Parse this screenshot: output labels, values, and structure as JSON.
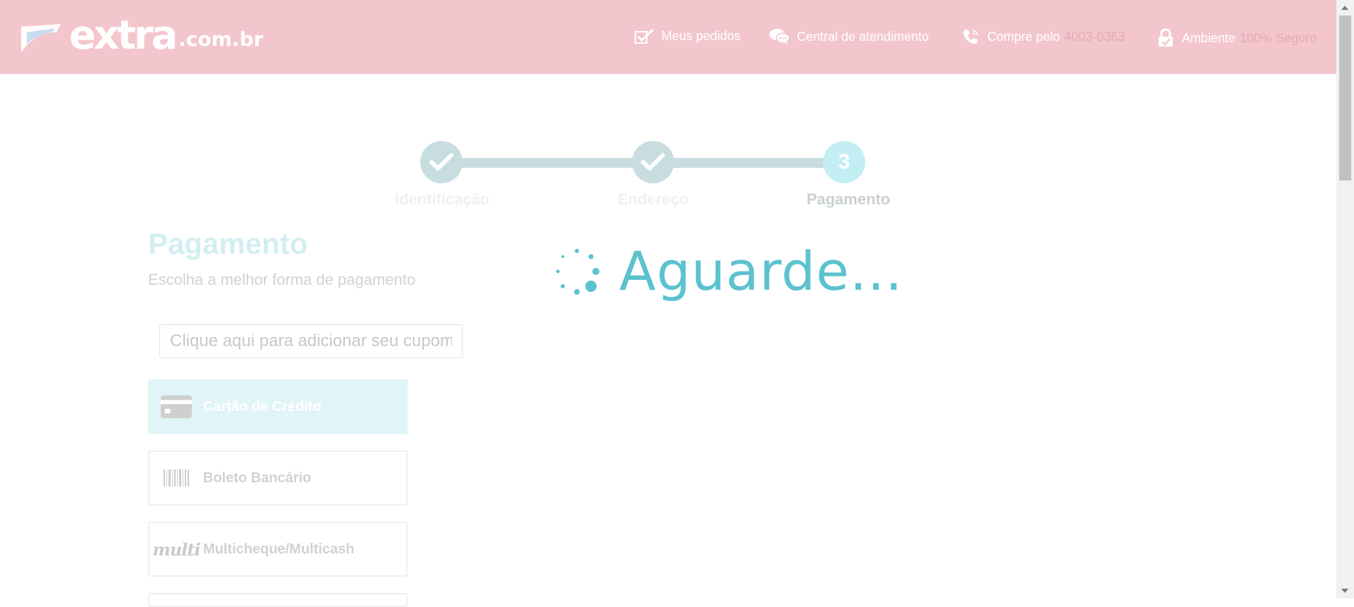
{
  "header": {
    "logo_main": "extra",
    "logo_sub": ".com.br",
    "my_orders": "Meus pedidos",
    "support": "Central de atendimento",
    "buy_by": "Compre pelo",
    "phone": "4003-0363",
    "environment": "Ambiente",
    "secure": "100% Seguro"
  },
  "stepper": {
    "steps": [
      {
        "label": "Identificação",
        "state": "done"
      },
      {
        "label": "Endereço",
        "state": "done"
      },
      {
        "label": "Pagamento",
        "state": "active",
        "number": "3"
      }
    ]
  },
  "payment": {
    "title": "Pagamento",
    "subtitle": "Escolha a melhor forma de pagamento",
    "coupon_placeholder": "Clique aqui para adicionar seu cupom",
    "options": [
      {
        "label": "Cartão de Crédito",
        "icon": "credit-card-icon",
        "selected": true
      },
      {
        "label": "Boleto Bancário",
        "icon": "barcode-icon",
        "selected": false
      },
      {
        "label": "Multicheque/Multicash",
        "icon": "multi-logo-icon",
        "icon_text": "multi",
        "selected": false
      }
    ]
  },
  "loading": {
    "text": "Aguarde..."
  },
  "colors": {
    "header_bg": "#f3c6cd",
    "accent": "#5cc2ce",
    "step_done": "#c7dde0",
    "step_active": "#c3eef3",
    "selected_option_bg": "#e1f4f8"
  }
}
